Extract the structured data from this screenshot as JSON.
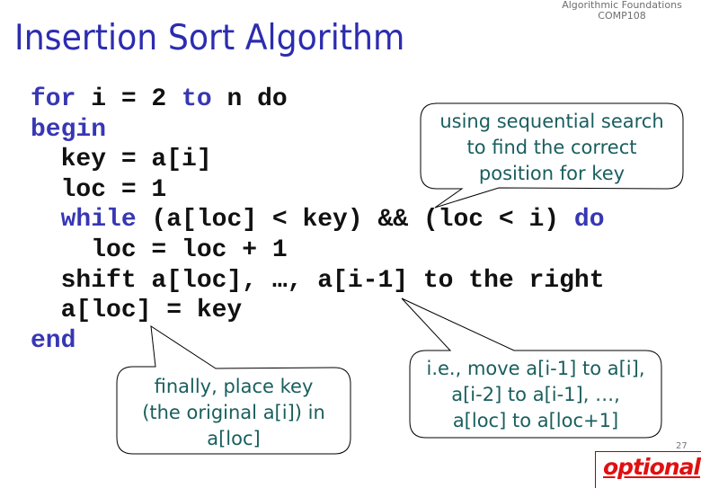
{
  "header": {
    "course_name": "Algorithmic Foundations",
    "course_code": "COMP108"
  },
  "title": "Insertion Sort Algorithm",
  "code": {
    "lines": [
      [
        {
          "t": "for",
          "kw": true
        },
        {
          "t": " i = 2 ",
          "kw": false
        },
        {
          "t": "to",
          "kw": true
        },
        {
          "t": " n do",
          "kw": false
        }
      ],
      [
        {
          "t": "begin",
          "kw": true
        }
      ],
      [
        {
          "t": "  key = a[i]",
          "kw": false
        }
      ],
      [
        {
          "t": "  loc = 1",
          "kw": false
        }
      ],
      [
        {
          "t": "  ",
          "kw": false
        },
        {
          "t": "while",
          "kw": true
        },
        {
          "t": " (a[loc] < key) && (loc < i) ",
          "kw": false
        },
        {
          "t": "do",
          "kw": true
        }
      ],
      [
        {
          "t": "    loc = loc + 1",
          "kw": false
        }
      ],
      [
        {
          "t": "  shift a[loc], …, a[i-1] to the right",
          "kw": false
        }
      ],
      [
        {
          "t": "  a[loc] = key",
          "kw": false
        }
      ],
      [
        {
          "t": "end",
          "kw": true
        }
      ]
    ]
  },
  "callouts": {
    "search": [
      "using sequential search",
      "to find the correct",
      "position for key"
    ],
    "place": [
      "finally, place key",
      "(the original a[i]) in",
      "a[loc]"
    ],
    "shift": [
      "i.e., move a[i-1] to a[i],",
      "a[i-2] to a[i-1], …,",
      "a[loc] to a[loc+1]"
    ]
  },
  "badge": {
    "label": "optional"
  },
  "page_number": "27",
  "colors": {
    "title": "#2c2cb0",
    "keyword": "#3737b4",
    "code": "#111111",
    "callout_text": "#1a5e5e",
    "optional": "#e01010"
  }
}
